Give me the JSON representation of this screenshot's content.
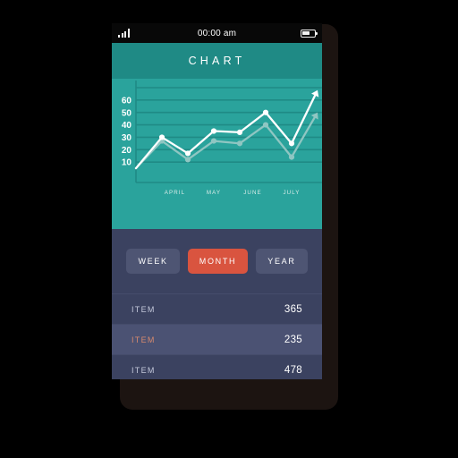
{
  "status_bar": {
    "time": "00:00 am",
    "signal_icon": "signal-bars-icon",
    "battery_icon": "battery-icon"
  },
  "header": {
    "title": "CHART"
  },
  "chart_data": {
    "type": "line",
    "title": "CHART",
    "xlabel": "",
    "ylabel": "",
    "grid": true,
    "legend": "none",
    "ylim": [
      0,
      70
    ],
    "y_ticks": [
      10,
      20,
      30,
      40,
      50,
      60
    ],
    "categories": [
      "APRIL",
      "MAY",
      "JUNE",
      "JULY"
    ],
    "x": [
      0,
      1,
      2,
      3,
      4,
      5,
      6,
      7
    ],
    "series": [
      {
        "name": "primary",
        "color": "#ffffff",
        "values": [
          5,
          30,
          17,
          35,
          34,
          50,
          25,
          68
        ],
        "arrow_end": true
      },
      {
        "name": "secondary",
        "color": "#8fc6c2",
        "values": [
          5,
          27,
          12,
          27,
          25,
          40,
          14,
          50
        ],
        "arrow_end": true
      }
    ]
  },
  "range_selector": {
    "options": [
      {
        "label": "WEEK",
        "active": false
      },
      {
        "label": "MONTH",
        "active": true
      },
      {
        "label": "YEAR",
        "active": false
      }
    ]
  },
  "item_list": {
    "rows": [
      {
        "label": "ITEM",
        "value": "365",
        "highlight": false
      },
      {
        "label": "ITEM",
        "value": "235",
        "highlight": true
      },
      {
        "label": "ITEM",
        "value": "478",
        "highlight": false
      }
    ]
  },
  "colors": {
    "header_teal": "#1f8a85",
    "chart_teal": "#2aa39c",
    "panel_navy": "#3b4260",
    "button_navy": "#4e5573",
    "accent_red": "#d9543f",
    "highlight_text": "#d88a6d",
    "phone_body": "#1c1411"
  }
}
